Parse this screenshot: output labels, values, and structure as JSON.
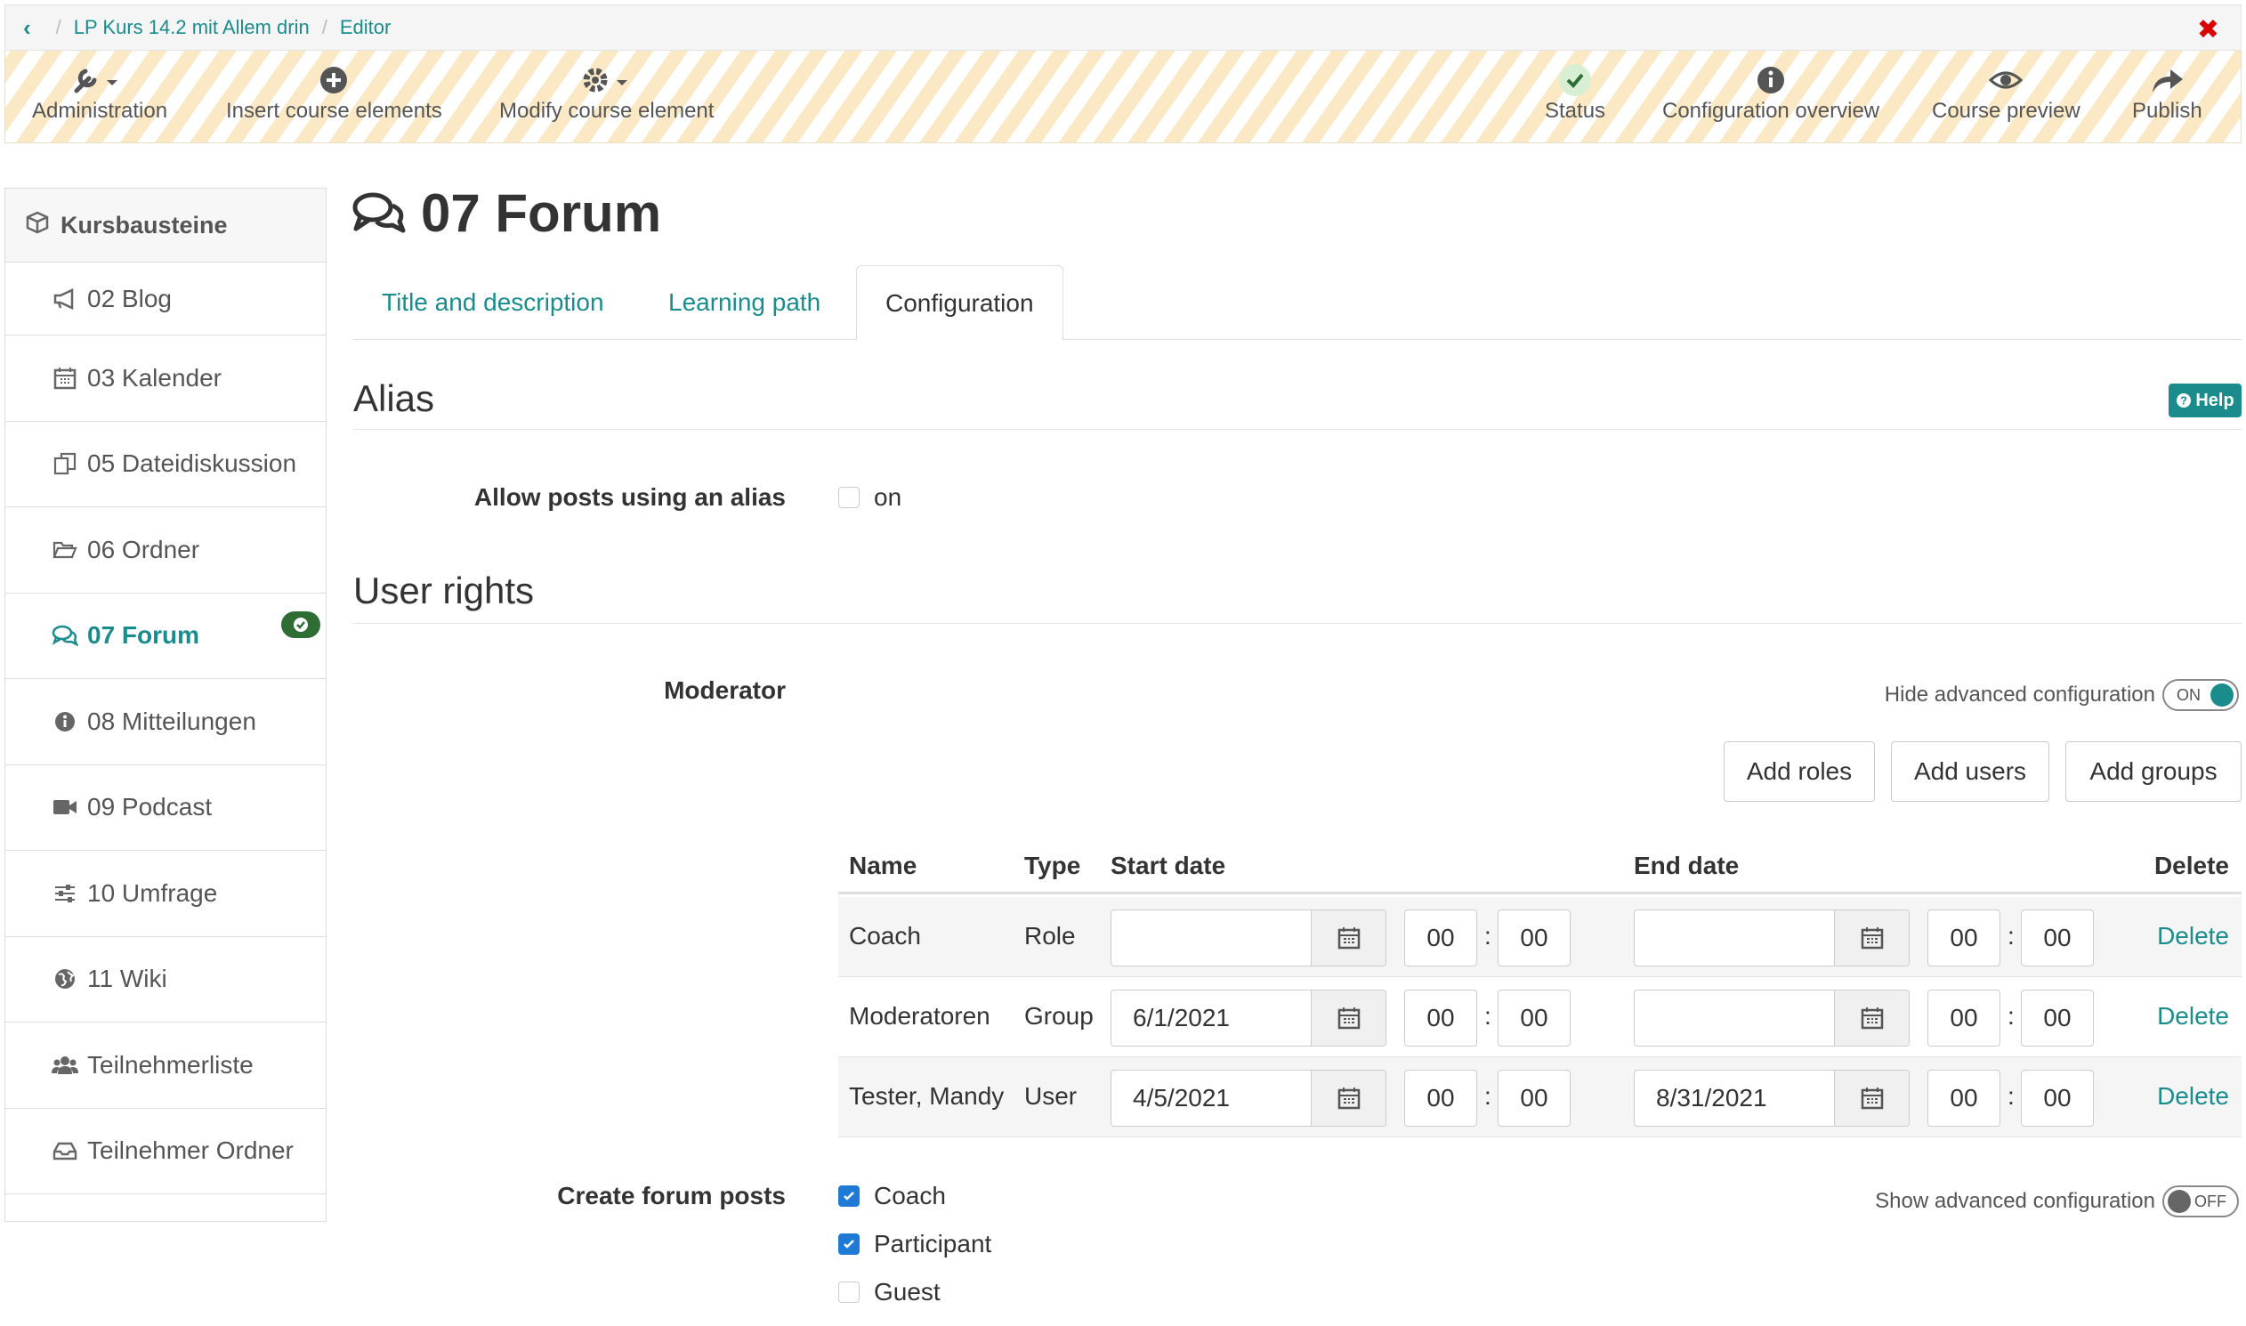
{
  "breadcrumb": {
    "course": "LP Kurs 14.2 mit Allem drin",
    "current": "Editor"
  },
  "toolbar": {
    "administration": "Administration",
    "insert": "Insert course elements",
    "modify": "Modify course element",
    "status": "Status",
    "config_overview": "Configuration overview",
    "preview": "Course preview",
    "publish": "Publish"
  },
  "sidebar": {
    "title": "Kursbausteine",
    "items": [
      {
        "label": "02 Blog",
        "icon": "megaphone-icon"
      },
      {
        "label": "03 Kalender",
        "icon": "calendar-icon"
      },
      {
        "label": "05 Dateidiskussion",
        "icon": "files-icon"
      },
      {
        "label": "06 Ordner",
        "icon": "folder-open-icon"
      },
      {
        "label": "07 Forum",
        "icon": "comments-icon",
        "active": true
      },
      {
        "label": "08 Mitteilungen",
        "icon": "info-icon"
      },
      {
        "label": "09 Podcast",
        "icon": "video-icon"
      },
      {
        "label": "10 Umfrage",
        "icon": "sliders-icon"
      },
      {
        "label": "11 Wiki",
        "icon": "globe-icon"
      },
      {
        "label": "Teilnehmerliste",
        "icon": "users-icon"
      },
      {
        "label": "Teilnehmer Ordner",
        "icon": "inbox-icon"
      }
    ]
  },
  "page": {
    "title": "07 Forum"
  },
  "tabs": {
    "title_desc": "Title and description",
    "learning_path": "Learning path",
    "configuration": "Configuration"
  },
  "alias": {
    "section": "Alias",
    "help": "Help",
    "label": "Allow posts using an alias",
    "checkbox_label": "on",
    "checked": false
  },
  "user_rights": {
    "section": "User rights",
    "moderator_label": "Moderator",
    "hide_advanced": "Hide advanced configuration",
    "toggle_on": "ON",
    "add_roles": "Add roles",
    "add_users": "Add users",
    "add_groups": "Add groups",
    "columns": {
      "name": "Name",
      "type": "Type",
      "start": "Start date",
      "end": "End date",
      "delete": "Delete"
    },
    "rows": [
      {
        "name": "Coach",
        "type": "Role",
        "start_date": "",
        "start_h": "00",
        "start_m": "00",
        "end_date": "",
        "end_h": "00",
        "end_m": "00",
        "delete": "Delete"
      },
      {
        "name": "Moderatoren",
        "type": "Group",
        "start_date": "6/1/2021",
        "start_h": "00",
        "start_m": "00",
        "end_date": "",
        "end_h": "00",
        "end_m": "00",
        "delete": "Delete"
      },
      {
        "name": "Tester, Mandy",
        "type": "User",
        "start_date": "4/5/2021",
        "start_h": "00",
        "start_m": "00",
        "end_date": "8/31/2021",
        "end_h": "00",
        "end_m": "00",
        "delete": "Delete"
      }
    ],
    "create_label": "Create forum posts",
    "show_advanced": "Show advanced configuration",
    "toggle_off": "OFF",
    "create_options": [
      {
        "label": "Coach",
        "checked": true
      },
      {
        "label": "Participant",
        "checked": true
      },
      {
        "label": "Guest",
        "checked": false
      }
    ]
  },
  "colors": {
    "accent": "#1a8c8c",
    "close": "#d90000",
    "badge": "#2e6e35",
    "checkbox": "#1f7ad6"
  }
}
